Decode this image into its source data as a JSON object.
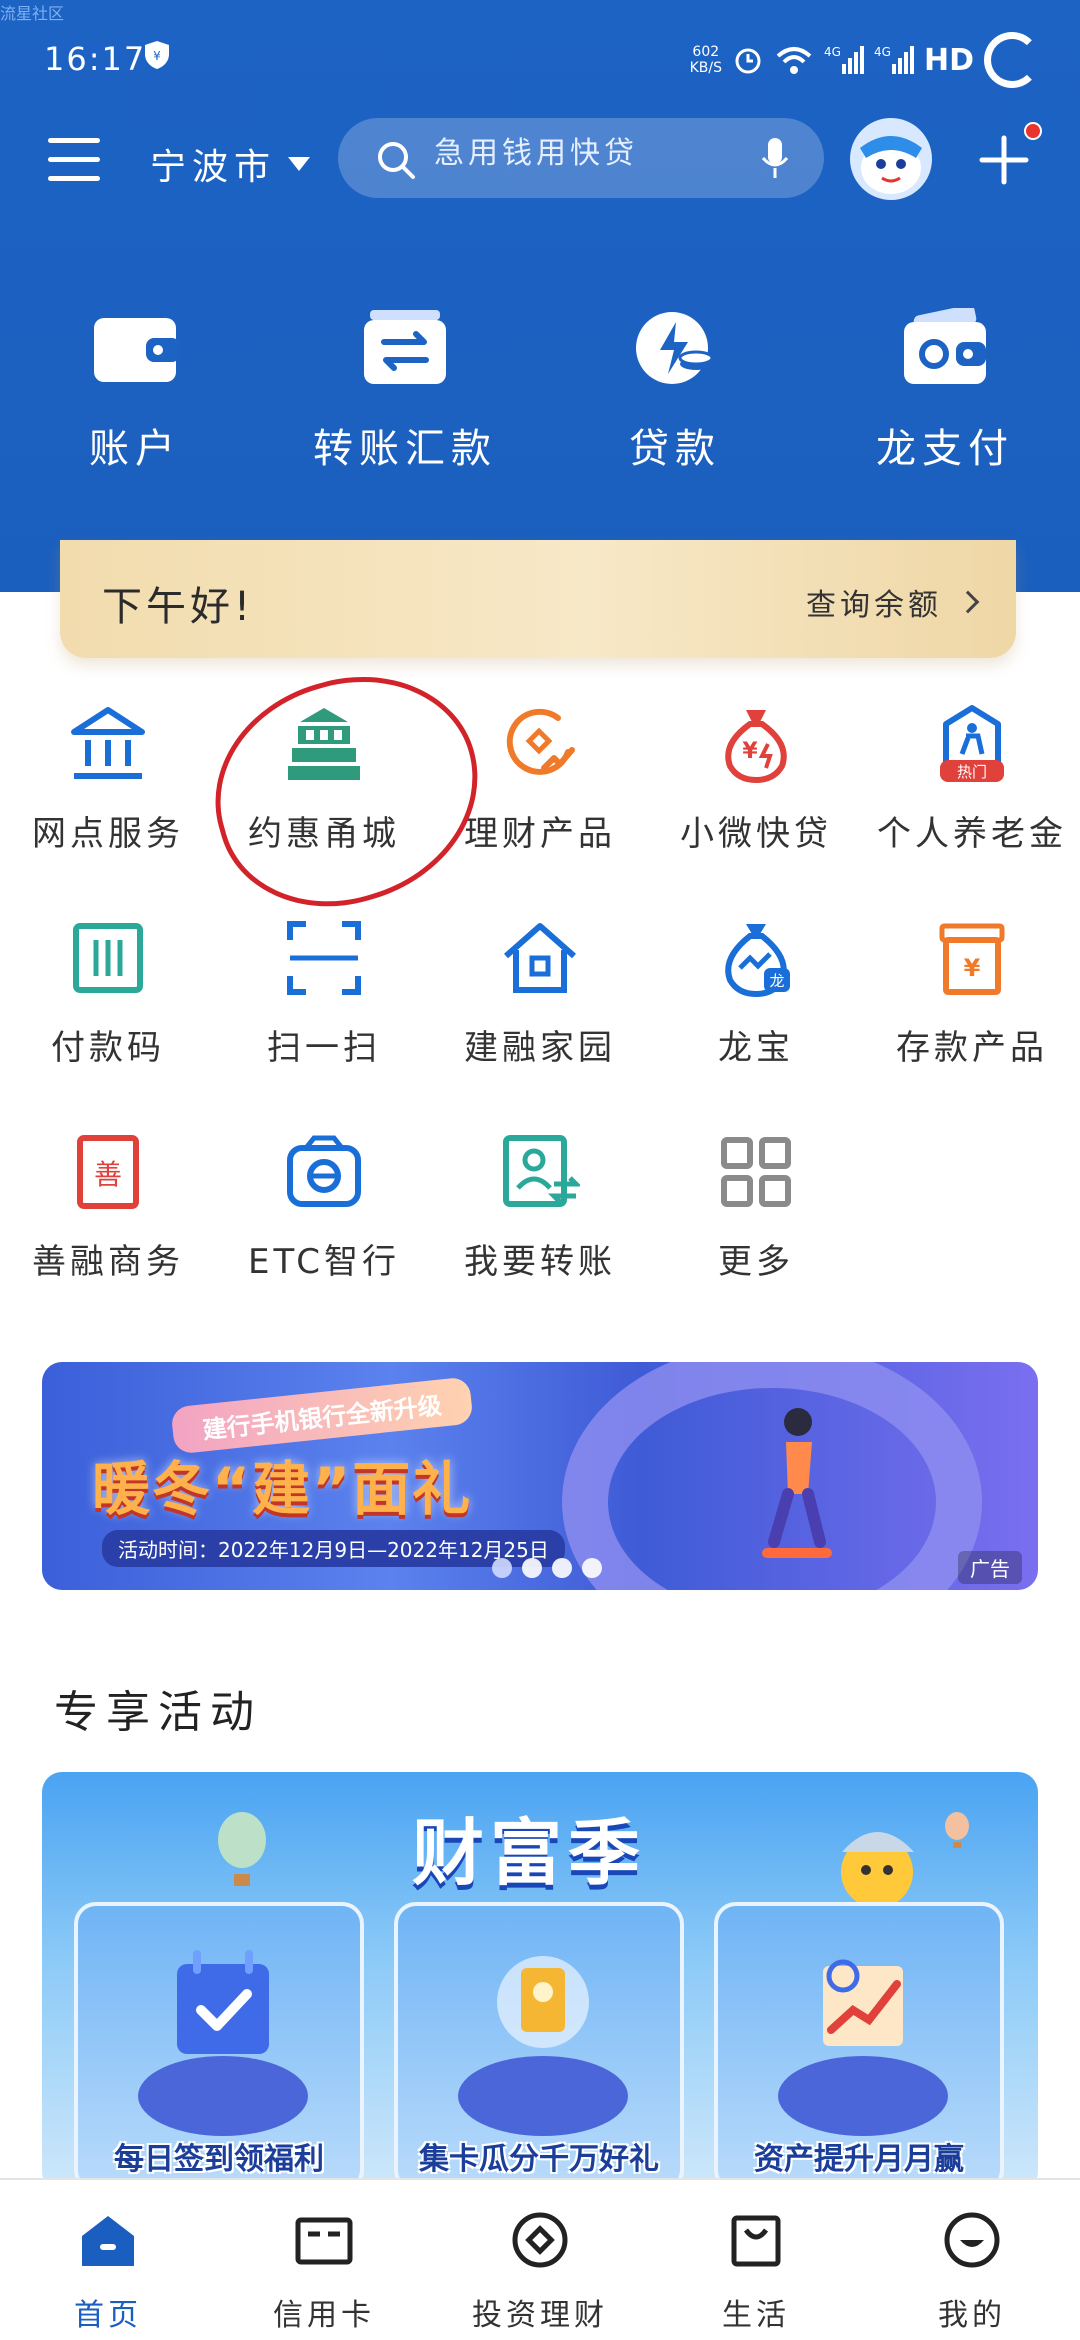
{
  "watermark": "流星社区",
  "status": {
    "time": "16:17",
    "net_speed_value": "602",
    "net_speed_unit": "KB/S",
    "hd_label": "HD",
    "network_1": "4G",
    "network_2": "4G"
  },
  "topbar": {
    "city": "宁波市",
    "search_placeholder": "急用钱用快贷"
  },
  "quick_actions": [
    {
      "label": "账户",
      "icon": "wallet-icon"
    },
    {
      "label": "转账汇款",
      "icon": "transfer-icon"
    },
    {
      "label": "贷款",
      "icon": "loan-icon"
    },
    {
      "label": "龙支付",
      "icon": "long-pay-icon"
    }
  ],
  "greeting": {
    "title": "下午好!",
    "link": "查询余额"
  },
  "services": [
    {
      "label": "网点服务",
      "icon": "bank-branch-icon",
      "color": "#1a6ed8"
    },
    {
      "label": "约惠甬城",
      "icon": "city-building-icon",
      "color": "#2f9b7c"
    },
    {
      "label": "理财产品",
      "icon": "wealth-icon",
      "color": "#f07a2a"
    },
    {
      "label": "小微快贷",
      "icon": "money-bag-icon",
      "color": "#e0413a"
    },
    {
      "label": "个人养老金",
      "icon": "pension-icon",
      "color": "#1a6ed8",
      "badge": "热门"
    },
    {
      "label": "付款码",
      "icon": "pay-code-icon",
      "color": "#2aa99a"
    },
    {
      "label": "扫一扫",
      "icon": "scan-icon",
      "color": "#1a6ed8"
    },
    {
      "label": "建融家园",
      "icon": "home-icon",
      "color": "#1a6ed8"
    },
    {
      "label": "龙宝",
      "icon": "long-bao-icon",
      "color": "#1a6ed8"
    },
    {
      "label": "存款产品",
      "icon": "deposit-icon",
      "color": "#f07a2a"
    },
    {
      "label": "善融商务",
      "icon": "shanrong-icon",
      "color": "#e0413a"
    },
    {
      "label": "ETC智行",
      "icon": "etc-icon",
      "color": "#1a6ed8"
    },
    {
      "label": "我要转账",
      "icon": "transfer-person-icon",
      "color": "#2aa99a"
    },
    {
      "label": "更多",
      "icon": "more-grid-icon",
      "color": "#8a8a8a"
    }
  ],
  "banner": {
    "tag": "建行手机银行全新升级",
    "title": "暖冬“建”面礼",
    "date": "活动时间：2022年12月9日—2022年12月25日",
    "ad": "广告"
  },
  "section_title": "专享活动",
  "activity": {
    "logo": "财富季",
    "cards": [
      {
        "label": "每日签到领福利"
      },
      {
        "label": "集卡瓜分千万好礼"
      },
      {
        "label": "资产提升月月赢"
      }
    ]
  },
  "bottom_nav": [
    {
      "label": "首页",
      "icon": "home-nav-icon",
      "active": true
    },
    {
      "label": "信用卡",
      "icon": "credit-card-icon",
      "active": false
    },
    {
      "label": "投资理财",
      "icon": "invest-icon",
      "active": false
    },
    {
      "label": "生活",
      "icon": "life-bag-icon",
      "active": false
    },
    {
      "label": "我的",
      "icon": "profile-icon",
      "active": false
    }
  ],
  "colors": {
    "header_blue": "#1d63c4",
    "accent_blue": "#1a5fc0",
    "highlight_red": "#d3232a"
  }
}
